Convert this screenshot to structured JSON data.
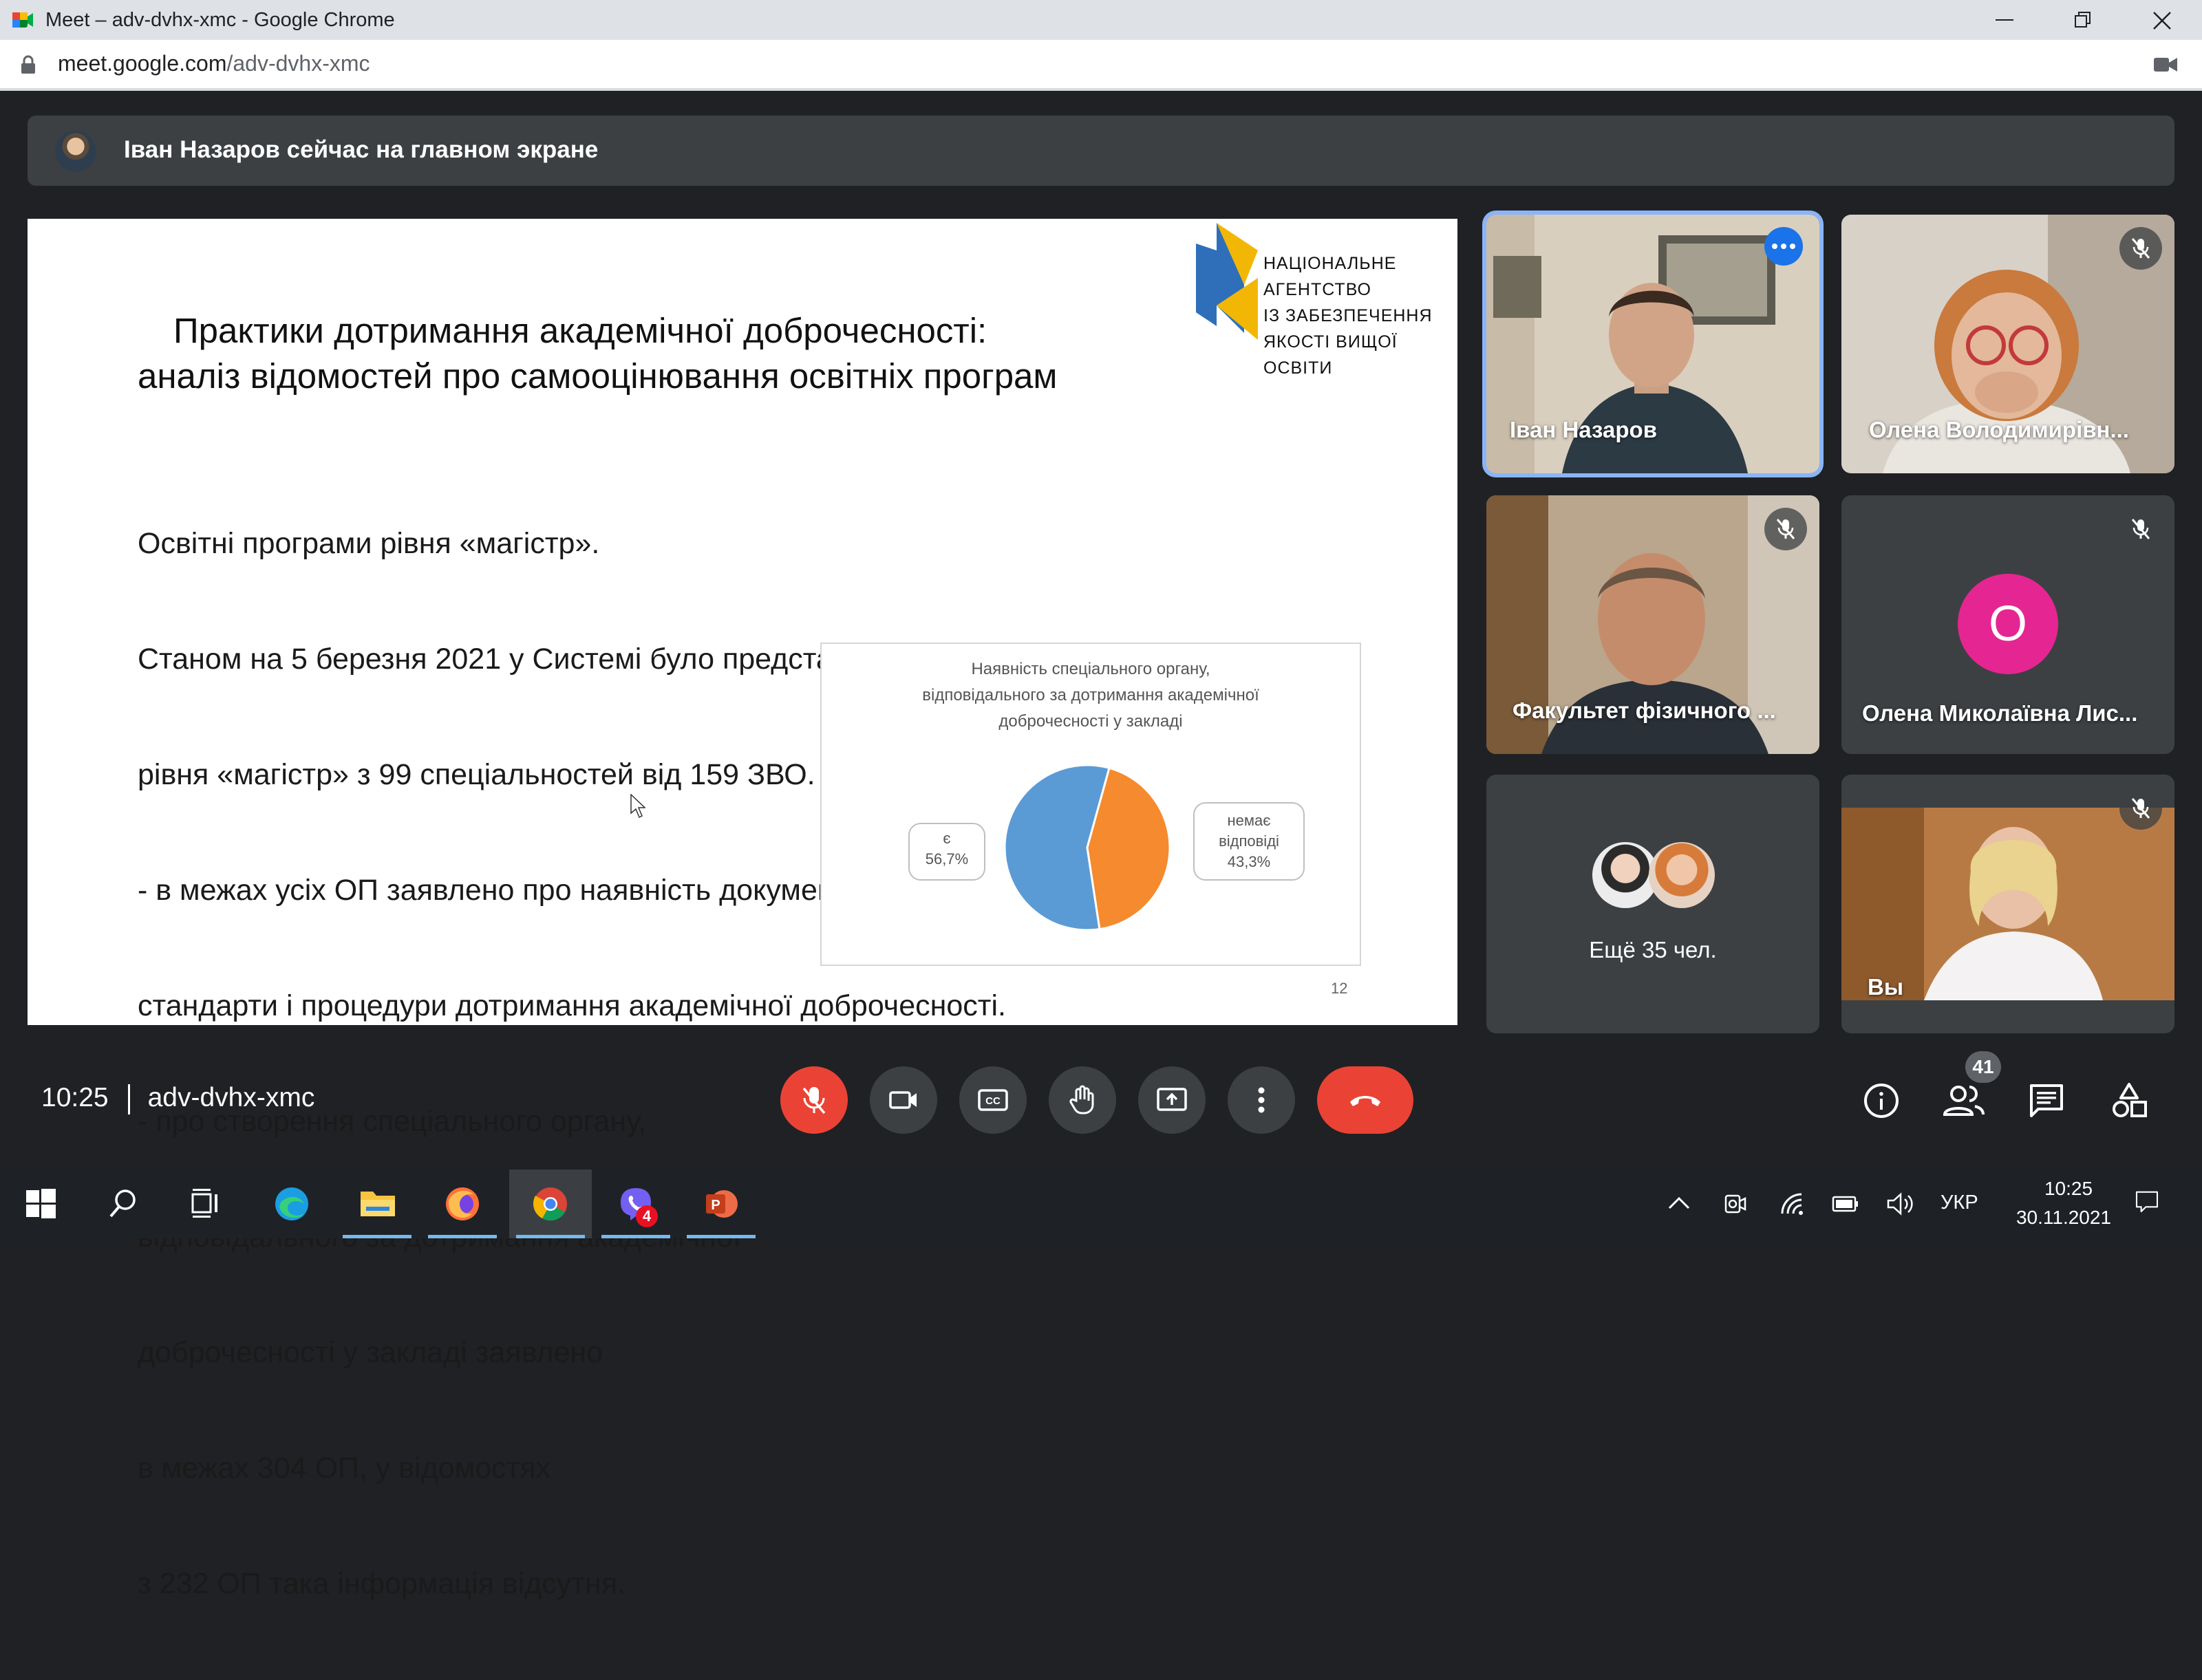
{
  "window": {
    "title": "Meet – adv-dvhx-xmc - Google Chrome",
    "url_host": "meet.google.com",
    "url_path": "/adv-dvhx-xmc"
  },
  "banner": {
    "text": "Іван Назаров сейчас на главном экране"
  },
  "slide": {
    "title_line1": "Практики дотримання академічної доброчесності:",
    "title_line2": "аналіз відомостей про самооцінювання освітніх програм",
    "logo_lines": [
      "НАЦІОНАЛЬНЕ",
      "АГЕНТСТВО",
      "ІЗ ЗАБЕЗПЕЧЕННЯ",
      "ЯКОСТІ ВИЩОЇ ОСВІТИ"
    ],
    "body_lines": [
      "Освітні програми рівня «магістр».",
      "Станом на 5 березня 2021 у Системі було представлено 539 освітніх програм",
      "рівня «магістр» з 99 спеціальностей від 159 ЗВО.",
      "- в межах усіх ОП заявлено про наявність документів, які визначають політику,",
      "стандарти і процедури дотримання академічної доброчесності.",
      "- про створення спеціального органу,",
      "відповідального за дотримання академічної",
      "доброчесності у закладі заявлено",
      "в межах 304 ОП, у відомостях",
      "з 232 ОП така інформація відсутня."
    ],
    "page_number": "12"
  },
  "chart_data": {
    "type": "pie",
    "title_lines": [
      "Наявність спеціального органу,",
      "відповідального за дотримання академічної",
      "доброчесності у закладі"
    ],
    "slices": [
      {
        "label": "є",
        "value": 56.7,
        "value_label": "56,7%",
        "color": "#5b9bd5"
      },
      {
        "label_lines": [
          "немає",
          "відповіді"
        ],
        "value": 43.3,
        "value_label": "43,3%",
        "color": "#f58a2e"
      }
    ]
  },
  "participants": [
    {
      "name": "Іван Назаров",
      "muted": false,
      "active_speaker": true
    },
    {
      "name": "Олена Володимирівн...",
      "muted": true
    },
    {
      "name": "Факультет фізичного ...",
      "muted": true
    },
    {
      "name": "Олена Миколаївна Лис...",
      "muted": true,
      "avatar_letter": "О"
    },
    {
      "name": "Ещё 35 чел.",
      "muted": false
    },
    {
      "name": "Вы",
      "muted": true
    }
  ],
  "meeting": {
    "time": "10:25",
    "code": "adv-dvhx-xmc",
    "participant_count": "41"
  },
  "colors": {
    "meet_bg": "#202124",
    "danger": "#ea4335",
    "active_border": "#8ab4f8",
    "avatar_pink": "#e52592"
  },
  "taskbar": {
    "viber_badge": "4",
    "lang": "УКР",
    "time": "10:25",
    "date": "30.11.2021"
  }
}
